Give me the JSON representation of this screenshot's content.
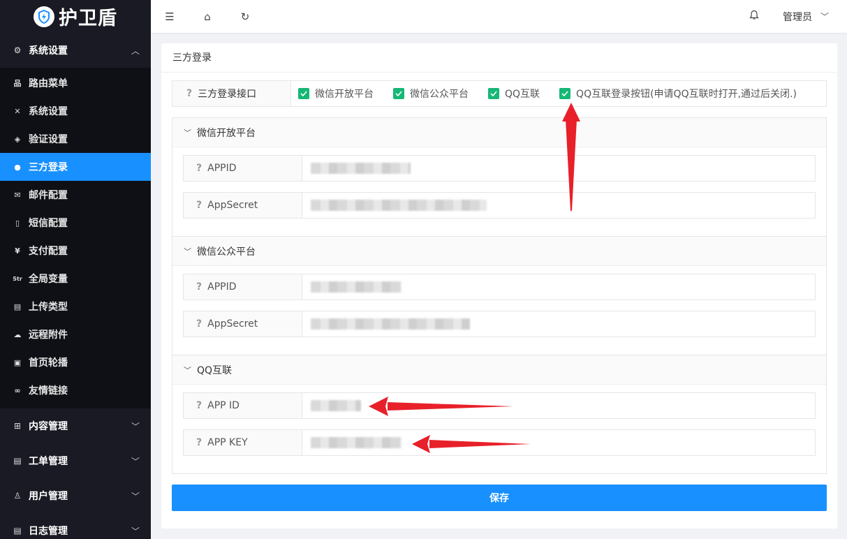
{
  "app": {
    "logo_text": "护卫盾"
  },
  "sidebar": {
    "system_group": "系统设置",
    "items": [
      {
        "label": "路由菜单",
        "icon": "sitemap-icon",
        "glyph": "品"
      },
      {
        "label": "系统设置",
        "icon": "tools-icon",
        "glyph": "✕"
      },
      {
        "label": "验证设置",
        "icon": "shield-check-icon",
        "glyph": "◈"
      },
      {
        "label": "三方登录",
        "icon": "wechat-icon",
        "glyph": "●"
      },
      {
        "label": "邮件配置",
        "icon": "mail-icon",
        "glyph": "✉"
      },
      {
        "label": "短信配置",
        "icon": "phone-icon",
        "glyph": "▯"
      },
      {
        "label": "支付配置",
        "icon": "yen-icon",
        "glyph": "¥"
      },
      {
        "label": "全局变量",
        "icon": "variable-icon",
        "glyph": "Str"
      },
      {
        "label": "上传类型",
        "icon": "file-icon",
        "glyph": "▤"
      },
      {
        "label": "远程附件",
        "icon": "cloud-icon",
        "glyph": "☁"
      },
      {
        "label": "首页轮播",
        "icon": "image-icon",
        "glyph": "▣"
      },
      {
        "label": "友情链接",
        "icon": "link-icon",
        "glyph": "∞"
      }
    ],
    "groups": [
      {
        "label": "内容管理",
        "icon": "grid-icon",
        "glyph": "⊞"
      },
      {
        "label": "工单管理",
        "icon": "ticket-icon",
        "glyph": "▤"
      },
      {
        "label": "用户管理",
        "icon": "user-icon",
        "glyph": "♙"
      },
      {
        "label": "日志管理",
        "icon": "log-icon",
        "glyph": "▤"
      }
    ]
  },
  "header": {
    "user_name": "管理员"
  },
  "main": {
    "card_title": "三方登录",
    "interface_label": "三方登录接口",
    "options": [
      {
        "label": "微信开放平台",
        "checked": true
      },
      {
        "label": "微信公众平台",
        "checked": true
      },
      {
        "label": "QQ互联",
        "checked": true
      },
      {
        "label": "QQ互联登录按钮(申请QQ互联时打开,通过后关闭.)",
        "checked": true
      }
    ],
    "sections": [
      {
        "title": "微信开放平台",
        "fields": [
          {
            "label": "APPID"
          },
          {
            "label": "AppSecret"
          }
        ]
      },
      {
        "title": "微信公众平台",
        "fields": [
          {
            "label": "APPID"
          },
          {
            "label": "AppSecret"
          }
        ]
      },
      {
        "title": "QQ互联",
        "fields": [
          {
            "label": "APP ID"
          },
          {
            "label": "APP KEY"
          }
        ]
      }
    ],
    "save_label": "保存"
  },
  "colors": {
    "sidebar_bg": "#191a23",
    "active": "#1890ff",
    "checkbox": "#16b777",
    "annotation_arrow": "#e8202a"
  }
}
